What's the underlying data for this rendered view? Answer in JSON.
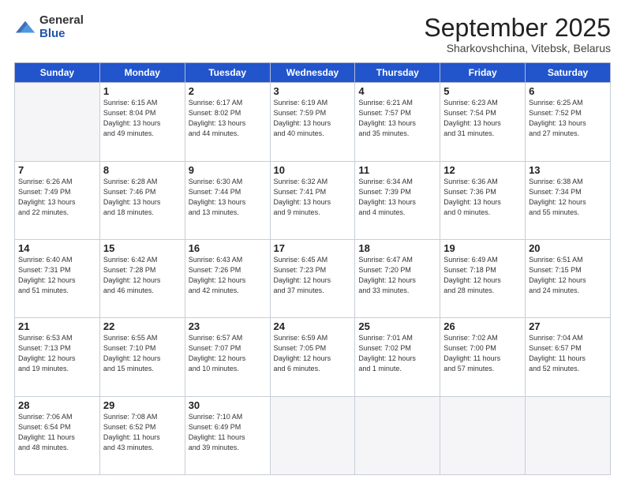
{
  "logo": {
    "general": "General",
    "blue": "Blue"
  },
  "title": {
    "month": "September 2025",
    "location": "Sharkovshchina, Vitebsk, Belarus"
  },
  "weekdays": [
    "Sunday",
    "Monday",
    "Tuesday",
    "Wednesday",
    "Thursday",
    "Friday",
    "Saturday"
  ],
  "weeks": [
    [
      {
        "day": "",
        "info": ""
      },
      {
        "day": "1",
        "info": "Sunrise: 6:15 AM\nSunset: 8:04 PM\nDaylight: 13 hours\nand 49 minutes."
      },
      {
        "day": "2",
        "info": "Sunrise: 6:17 AM\nSunset: 8:02 PM\nDaylight: 13 hours\nand 44 minutes."
      },
      {
        "day": "3",
        "info": "Sunrise: 6:19 AM\nSunset: 7:59 PM\nDaylight: 13 hours\nand 40 minutes."
      },
      {
        "day": "4",
        "info": "Sunrise: 6:21 AM\nSunset: 7:57 PM\nDaylight: 13 hours\nand 35 minutes."
      },
      {
        "day": "5",
        "info": "Sunrise: 6:23 AM\nSunset: 7:54 PM\nDaylight: 13 hours\nand 31 minutes."
      },
      {
        "day": "6",
        "info": "Sunrise: 6:25 AM\nSunset: 7:52 PM\nDaylight: 13 hours\nand 27 minutes."
      }
    ],
    [
      {
        "day": "7",
        "info": "Sunrise: 6:26 AM\nSunset: 7:49 PM\nDaylight: 13 hours\nand 22 minutes."
      },
      {
        "day": "8",
        "info": "Sunrise: 6:28 AM\nSunset: 7:46 PM\nDaylight: 13 hours\nand 18 minutes."
      },
      {
        "day": "9",
        "info": "Sunrise: 6:30 AM\nSunset: 7:44 PM\nDaylight: 13 hours\nand 13 minutes."
      },
      {
        "day": "10",
        "info": "Sunrise: 6:32 AM\nSunset: 7:41 PM\nDaylight: 13 hours\nand 9 minutes."
      },
      {
        "day": "11",
        "info": "Sunrise: 6:34 AM\nSunset: 7:39 PM\nDaylight: 13 hours\nand 4 minutes."
      },
      {
        "day": "12",
        "info": "Sunrise: 6:36 AM\nSunset: 7:36 PM\nDaylight: 13 hours\nand 0 minutes."
      },
      {
        "day": "13",
        "info": "Sunrise: 6:38 AM\nSunset: 7:34 PM\nDaylight: 12 hours\nand 55 minutes."
      }
    ],
    [
      {
        "day": "14",
        "info": "Sunrise: 6:40 AM\nSunset: 7:31 PM\nDaylight: 12 hours\nand 51 minutes."
      },
      {
        "day": "15",
        "info": "Sunrise: 6:42 AM\nSunset: 7:28 PM\nDaylight: 12 hours\nand 46 minutes."
      },
      {
        "day": "16",
        "info": "Sunrise: 6:43 AM\nSunset: 7:26 PM\nDaylight: 12 hours\nand 42 minutes."
      },
      {
        "day": "17",
        "info": "Sunrise: 6:45 AM\nSunset: 7:23 PM\nDaylight: 12 hours\nand 37 minutes."
      },
      {
        "day": "18",
        "info": "Sunrise: 6:47 AM\nSunset: 7:20 PM\nDaylight: 12 hours\nand 33 minutes."
      },
      {
        "day": "19",
        "info": "Sunrise: 6:49 AM\nSunset: 7:18 PM\nDaylight: 12 hours\nand 28 minutes."
      },
      {
        "day": "20",
        "info": "Sunrise: 6:51 AM\nSunset: 7:15 PM\nDaylight: 12 hours\nand 24 minutes."
      }
    ],
    [
      {
        "day": "21",
        "info": "Sunrise: 6:53 AM\nSunset: 7:13 PM\nDaylight: 12 hours\nand 19 minutes."
      },
      {
        "day": "22",
        "info": "Sunrise: 6:55 AM\nSunset: 7:10 PM\nDaylight: 12 hours\nand 15 minutes."
      },
      {
        "day": "23",
        "info": "Sunrise: 6:57 AM\nSunset: 7:07 PM\nDaylight: 12 hours\nand 10 minutes."
      },
      {
        "day": "24",
        "info": "Sunrise: 6:59 AM\nSunset: 7:05 PM\nDaylight: 12 hours\nand 6 minutes."
      },
      {
        "day": "25",
        "info": "Sunrise: 7:01 AM\nSunset: 7:02 PM\nDaylight: 12 hours\nand 1 minute."
      },
      {
        "day": "26",
        "info": "Sunrise: 7:02 AM\nSunset: 7:00 PM\nDaylight: 11 hours\nand 57 minutes."
      },
      {
        "day": "27",
        "info": "Sunrise: 7:04 AM\nSunset: 6:57 PM\nDaylight: 11 hours\nand 52 minutes."
      }
    ],
    [
      {
        "day": "28",
        "info": "Sunrise: 7:06 AM\nSunset: 6:54 PM\nDaylight: 11 hours\nand 48 minutes."
      },
      {
        "day": "29",
        "info": "Sunrise: 7:08 AM\nSunset: 6:52 PM\nDaylight: 11 hours\nand 43 minutes."
      },
      {
        "day": "30",
        "info": "Sunrise: 7:10 AM\nSunset: 6:49 PM\nDaylight: 11 hours\nand 39 minutes."
      },
      {
        "day": "",
        "info": ""
      },
      {
        "day": "",
        "info": ""
      },
      {
        "day": "",
        "info": ""
      },
      {
        "day": "",
        "info": ""
      }
    ]
  ]
}
